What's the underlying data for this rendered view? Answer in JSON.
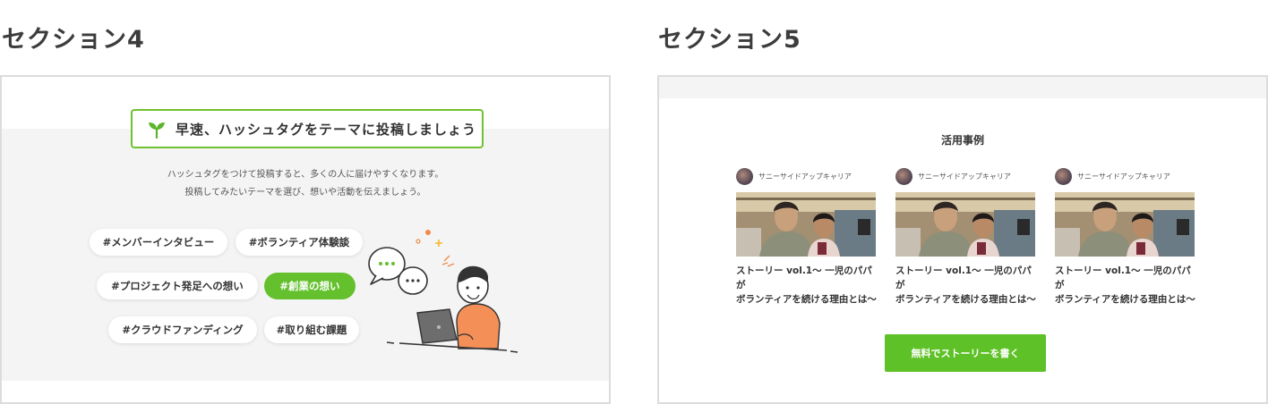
{
  "section4": {
    "title": "セクション4",
    "banner": "早速、ハッシュタグをテーマに投稿しましょう",
    "description": [
      "ハッシュタグをつけて投稿すると、多くの人に届けやすくなります。",
      "投稿してみたいテーマを選び、想いや活動を伝えましょう。"
    ],
    "tags": [
      "#メンバーインタビュー",
      "#ボランティア体験談",
      "#プロジェクト発足への想い",
      "#創業の想い",
      "#クラウドファンディング",
      "#取り組む課題"
    ],
    "active_tag": "#創業の想い",
    "accent_color": "#64c02c"
  },
  "section5": {
    "title": "セクション5",
    "heading": "活用事例",
    "cards": [
      {
        "author": "サニーサイドアップキャリア",
        "story_line1": "ストーリー vol.1〜 一児のパパが",
        "story_line2": "ボランティアを続ける理由とは〜"
      },
      {
        "author": "サニーサイドアップキャリア",
        "story_line1": "ストーリー vol.1〜 一児のパパが",
        "story_line2": "ボランティアを続ける理由とは〜"
      },
      {
        "author": "サニーサイドアップキャリア",
        "story_line1": "ストーリー vol.1〜 一児のパパが",
        "story_line2": "ボランティアを続ける理由とは〜"
      }
    ],
    "cta_label": "無料でストーリーを書く",
    "cta_color": "#5ec127"
  },
  "icons": {
    "banner_icon": "sprout-icon",
    "illustration": "person-with-laptop-illustration",
    "avatar": "avatar"
  }
}
